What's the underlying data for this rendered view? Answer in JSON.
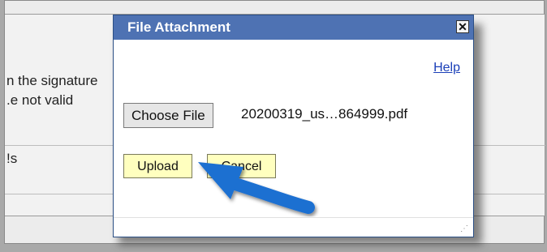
{
  "background": {
    "line1": "n the signature",
    "line2": "e not valid.",
    "line3": "s!"
  },
  "dialog": {
    "title": "File Attachment",
    "close_symbol": "✕",
    "help_label": "Help",
    "choose_label": "Choose File",
    "file_name": "20200319_us…864999.pdf",
    "upload_label": "Upload",
    "cancel_label": "Cancel",
    "resize_grip": "⋰"
  },
  "annotation": {
    "arrow_color": "#1f6fd1",
    "icon": "pointer-arrow-icon"
  },
  "colors": {
    "titlebar": "#4e72b3",
    "button_bg": "#ffffbf",
    "link": "#1a3fb8"
  }
}
